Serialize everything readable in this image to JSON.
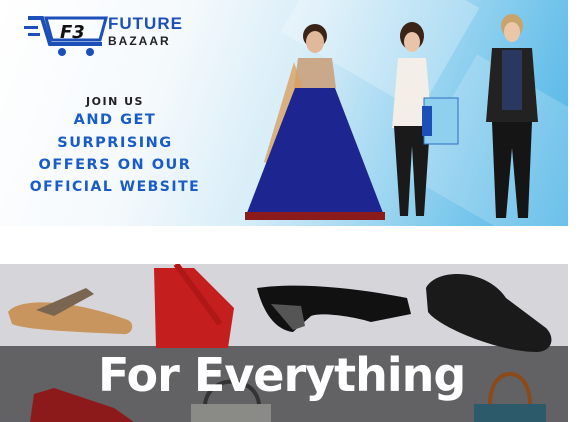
{
  "banner_top": {
    "logo": {
      "mark": "F3",
      "line1": "FUTURE",
      "line2": "BAZAAR"
    },
    "promo_lines": [
      "JOIN US",
      "AND GET",
      "SURPRISING",
      "OFFERS ON OUR",
      "OFFICIAL WEBSITE"
    ]
  },
  "banner_bottom": {
    "headline": "For Everything"
  },
  "colors": {
    "brand_blue": "#1a5cc6",
    "band_dark": "#626265",
    "band_light": "#d6d6da"
  }
}
